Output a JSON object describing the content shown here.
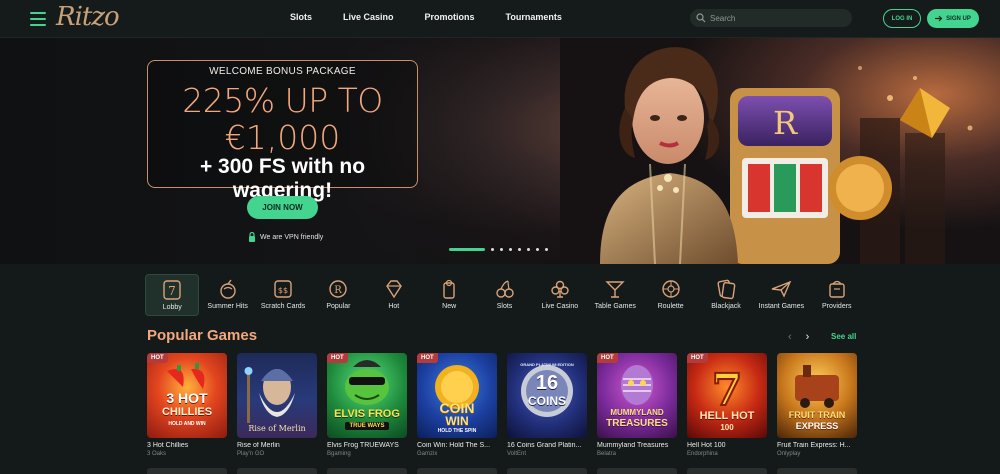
{
  "header": {
    "logo": "Ritzo",
    "nav": [
      "Slots",
      "Live Casino",
      "Promotions",
      "Tournaments"
    ],
    "search_placeholder": "Search",
    "login_label": "LOG IN",
    "signup_label": "SIGN UP"
  },
  "hero": {
    "kicker": "WELCOME BONUS PACKAGE",
    "line1": "225% UP TO",
    "line2": "€1,000",
    "line3": "+ 300 FS with no wagering!",
    "cta": "JOIN NOW",
    "vpn_note": "We are VPN friendly",
    "slides_total": 8,
    "active_slide": 1
  },
  "categories": [
    {
      "label": "Lobby",
      "icon": "lobby-7-icon",
      "active": true
    },
    {
      "label": "Summer Hits",
      "icon": "cocktail-fruit-icon"
    },
    {
      "label": "Scratch Cards",
      "icon": "scratch-card-icon"
    },
    {
      "label": "Popular",
      "icon": "crest-r-icon"
    },
    {
      "label": "Hot",
      "icon": "diamond-icon"
    },
    {
      "label": "New",
      "icon": "door-hanger-icon"
    },
    {
      "label": "Slots",
      "icon": "cherries-icon"
    },
    {
      "label": "Live Casino",
      "icon": "club-suit-icon"
    },
    {
      "label": "Table Games",
      "icon": "martini-icon"
    },
    {
      "label": "Roulette",
      "icon": "roulette-icon"
    },
    {
      "label": "Blackjack",
      "icon": "cards-icon"
    },
    {
      "label": "Instant Games",
      "icon": "plane-icon"
    },
    {
      "label": "Providers",
      "icon": "provider-box-icon"
    }
  ],
  "popular": {
    "title": "Popular Games",
    "see_all": "See all",
    "hot_badge": "HOT",
    "games": [
      {
        "title": "3 Hot Chillies",
        "provider": "3 Oaks",
        "hot": true,
        "art_line1": "3 HOT",
        "art_line2": "CHILLIES",
        "art_line3": "HOLD AND WIN"
      },
      {
        "title": "Rise of Merlin",
        "provider": "Play'n GO",
        "hot": false,
        "art_line1": "Rise of Merlin",
        "art_line2": "",
        "art_line3": ""
      },
      {
        "title": "Elvis Frog TRUEWAYS",
        "provider": "Bgaming",
        "hot": true,
        "art_line1": "ELVIS FROG",
        "art_line2": "TRUE WAYS",
        "art_line3": ""
      },
      {
        "title": "Coin Win: Hold The S...",
        "provider": "Gamzix",
        "hot": true,
        "art_line1": "COIN",
        "art_line2": "WIN",
        "art_line3": "HOLD THE SPIN"
      },
      {
        "title": "16 Coins Grand Platin...",
        "provider": "VoltEnt",
        "hot": false,
        "art_line1": "16",
        "art_line2": "COINS",
        "art_line3": "GRAND PLATINUM EDITION"
      },
      {
        "title": "Mummyland Treasures",
        "provider": "Belatra",
        "hot": true,
        "art_line1": "MUMMYLAND",
        "art_line2": "TREASURES",
        "art_line3": ""
      },
      {
        "title": "Hell Hot 100",
        "provider": "Endorphina",
        "hot": true,
        "art_line1": "HELL HOT",
        "art_line2": "100",
        "art_line3": ""
      },
      {
        "title": "Fruit Train Express: H...",
        "provider": "Onlyplay",
        "hot": false,
        "art_line1": "FRUIT TRAIN",
        "art_line2": "EXPRESS",
        "art_line3": ""
      }
    ]
  },
  "colors": {
    "accent": "#43d58f",
    "gold": "#f2a77c",
    "background": "#141a19",
    "hot_badge": "#b43b3b"
  }
}
